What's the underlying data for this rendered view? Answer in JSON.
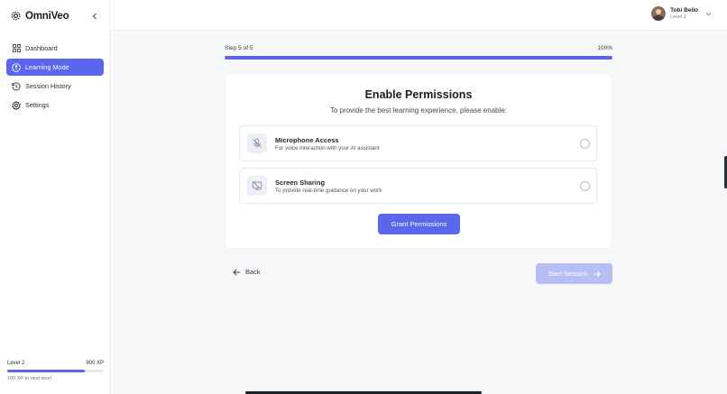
{
  "brand": {
    "name": "OmniVeo",
    "logo_icon": "omniveo-logo-icon"
  },
  "sidebar": {
    "collapse_icon": "chevron-left-icon",
    "items": [
      {
        "label": "Dashboard",
        "icon": "grid-icon",
        "active": false
      },
      {
        "label": "Learning Mode",
        "icon": "info-circle-icon",
        "active": true
      },
      {
        "label": "Session History",
        "icon": "history-icon",
        "active": false
      },
      {
        "label": "Settings",
        "icon": "gear-icon",
        "active": false
      }
    ],
    "level": {
      "label": "Level 2",
      "xp": "900 XP",
      "progress": 0.8,
      "hint": "100 XP to next level"
    }
  },
  "user": {
    "name": "Tobi Bello",
    "level": "Level 2"
  },
  "wizard": {
    "step_text": "Step 5 of 5",
    "percent_text": "100%",
    "progress": 1.0,
    "title": "Enable Permissions",
    "subtitle": "To provide the best learning experience, please enable:",
    "permissions": [
      {
        "title": "Microphone Access",
        "description": "For voice interaction with your AI assistant",
        "icon": "microphone-off-icon",
        "checked": false
      },
      {
        "title": "Screen Sharing",
        "description": "To provide real-time guidance on your work",
        "icon": "screen-share-off-icon",
        "checked": false
      }
    ],
    "grant_label": "Grant Permissions",
    "back_label": "Back",
    "start_label": "Start Session"
  },
  "colors": {
    "accent": "#5a66ec",
    "accent_disabled": "#b7bdf5"
  }
}
